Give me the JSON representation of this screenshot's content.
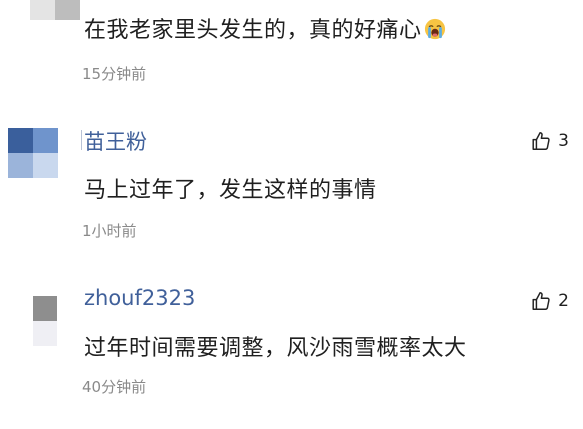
{
  "comments": [
    {
      "username": "",
      "text": "在我老家里头发生的，真的好痛心",
      "emoji": "loudly-crying-face",
      "time": "15分钟前",
      "likes": ""
    },
    {
      "username": "苗王粉",
      "text": "马上过年了，发生这样的事情",
      "time": "1小时前",
      "likes": "3"
    },
    {
      "username": "zhouf2323",
      "text": "过年时间需要调整，风沙雨雪概率太大",
      "time": "40分钟前",
      "likes": "2"
    }
  ],
  "colors": {
    "username": "#40609a",
    "text": "#1f1f1f",
    "time": "#8a8a8a"
  }
}
